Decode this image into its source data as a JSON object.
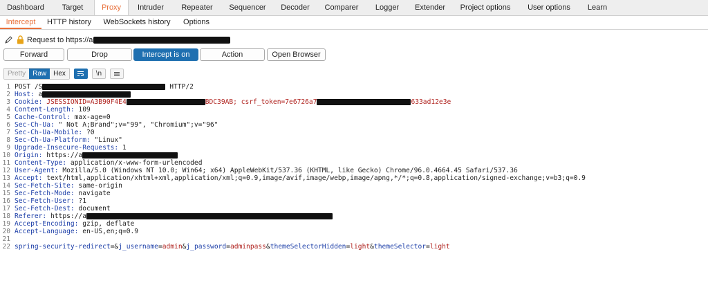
{
  "top_tabs": [
    "Dashboard",
    "Target",
    "Proxy",
    "Intruder",
    "Repeater",
    "Sequencer",
    "Decoder",
    "Comparer",
    "Logger",
    "Extender",
    "Project options",
    "User options",
    "Learn"
  ],
  "sub_tabs": [
    "Intercept",
    "HTTP history",
    "WebSockets history",
    "Options"
  ],
  "request_to": "Request to https://a",
  "buttons": {
    "forward": "Forward",
    "drop": "Drop",
    "intercept": "Intercept is on",
    "action": "Action",
    "open_browser": "Open Browser"
  },
  "view": {
    "pretty": "Pretty",
    "raw": "Raw",
    "hex": "Hex",
    "newline": "\\n"
  },
  "lines": {
    "l1": {
      "a": "POST /S",
      "b": " HTTP/2"
    },
    "l2": {
      "k": "Host:",
      "v": " a"
    },
    "l3": {
      "k": "Cookie:",
      "v": " JSESSIONID=A3B90F4E4",
      "v2": "BDC39AB;",
      "k2": " csrf_token=7e6726a7",
      "v3": "633ad12e3e"
    },
    "l4": {
      "k": "Content-Length:",
      "v": " 109"
    },
    "l5": {
      "k": "Cache-Control:",
      "v": " max-age=0"
    },
    "l6": {
      "k": "Sec-Ch-Ua:",
      "v": " \" Not A;Brand\";v=\"99\", \"Chromium\";v=\"96\""
    },
    "l7": {
      "k": "Sec-Ch-Ua-Mobile:",
      "v": " ?0"
    },
    "l8": {
      "k": "Sec-Ch-Ua-Platform:",
      "v": " \"Linux\""
    },
    "l9": {
      "k": "Upgrade-Insecure-Requests:",
      "v": " 1"
    },
    "l10": {
      "k": "Origin:",
      "v": " https://a"
    },
    "l11": {
      "k": "Content-Type:",
      "v": " application/x-www-form-urlencoded"
    },
    "l12": {
      "k": "User-Agent:",
      "v": " Mozilla/5.0 (Windows NT 10.0; Win64; x64) AppleWebKit/537.36 (KHTML, like Gecko) Chrome/96.0.4664.45 Safari/537.36"
    },
    "l13": {
      "k": "Accept:",
      "v": " text/html,application/xhtml+xml,application/xml;q=0.9,image/avif,image/webp,image/apng,*/*;q=0.8,application/signed-exchange;v=b3;q=0.9"
    },
    "l14": {
      "k": "Sec-Fetch-Site:",
      "v": " same-origin"
    },
    "l15": {
      "k": "Sec-Fetch-Mode:",
      "v": " navigate"
    },
    "l16": {
      "k": "Sec-Fetch-User:",
      "v": " ?1"
    },
    "l17": {
      "k": "Sec-Fetch-Dest:",
      "v": " document"
    },
    "l18": {
      "k": "Referer:",
      "v": " https://a"
    },
    "l19": {
      "k": "Accept-Encoding:",
      "v": " gzip, deflate"
    },
    "l20": {
      "k": "Accept-Language:",
      "v": " en-US,en;q=0.9"
    },
    "l22": {
      "p1k": "spring-security-redirect",
      "p1v": "",
      "p2k": "j_username",
      "p2v": "admin",
      "p3k": "j_password",
      "p3v": "adminpass",
      "p4k": "themeSelectorHidden",
      "p4v": "light",
      "p5k": "themeSelector",
      "p5v": "light"
    }
  },
  "line_numbers": [
    "1",
    "2",
    "3",
    "4",
    "5",
    "6",
    "7",
    "8",
    "9",
    "10",
    "11",
    "12",
    "13",
    "14",
    "15",
    "16",
    "17",
    "18",
    "19",
    "20",
    "21",
    "22"
  ]
}
